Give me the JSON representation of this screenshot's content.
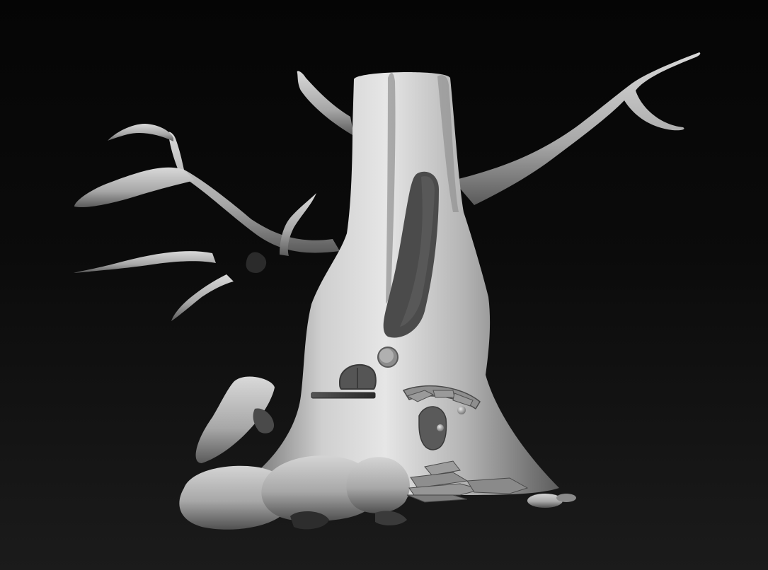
{
  "viewport": {
    "background_top": "#050505",
    "background_bottom": "#1b1b1b"
  },
  "model": {
    "subject": "tree-house-sculpt",
    "base_color": "#a8a8a8",
    "highlight_color": "#e2e2e2",
    "shadow_color": "#3c3c3c",
    "cavity_color": "#4a4a4a"
  }
}
